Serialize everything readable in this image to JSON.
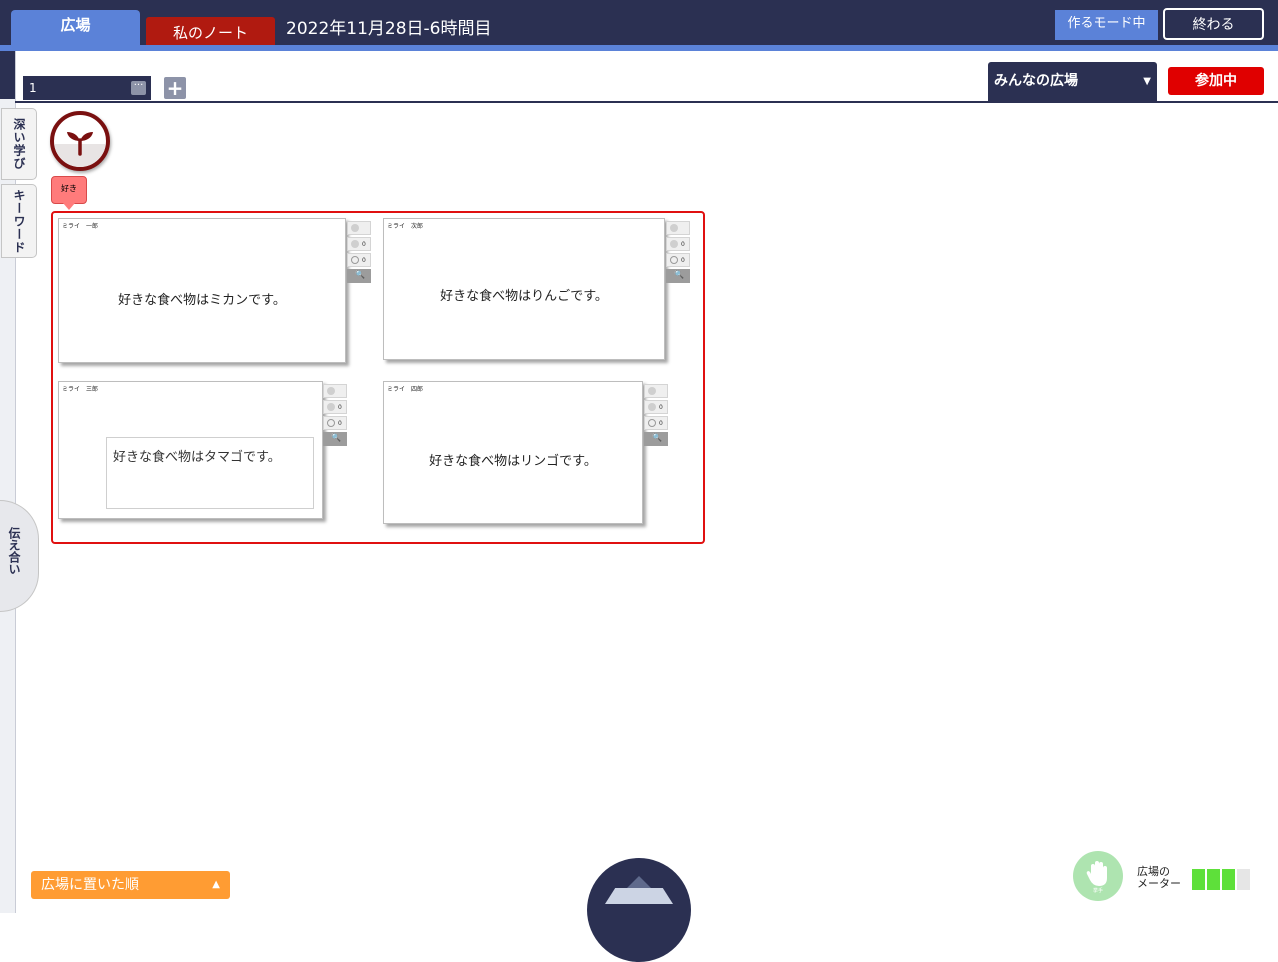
{
  "header": {
    "tab_hiroba": "広場",
    "tab_note": "私のノート",
    "session_title": "2022年11月28日-6時間目",
    "mode_button": "作るモード中",
    "end_button": "終わる"
  },
  "sidebar": {
    "tab_deep": "深い学び",
    "tab_keyword": "キーワード",
    "tab_tsutae": "伝え合い"
  },
  "toolbar": {
    "page_tab_label": "1",
    "page_tab_more": "···",
    "add_page": "+",
    "space_select": "みんなの広場",
    "join_button": "参加中"
  },
  "group": {
    "tag_label": "好き"
  },
  "cards": [
    {
      "author": "ミライ　一郎",
      "text": "好きな食べ物はミカンです。",
      "count_a": "0",
      "count_b": "0"
    },
    {
      "author": "ミライ　次郎",
      "text": "好きな食べ物はりんごです。",
      "count_a": "0",
      "count_b": "0"
    },
    {
      "author": "ミライ　三郎",
      "text": "好きな食べ物はタマゴです。",
      "count_a": "0",
      "count_b": "0"
    },
    {
      "author": "ミライ　四郎",
      "text": "好きな食べ物はリンゴです。",
      "count_a": "0",
      "count_b": "0"
    }
  ],
  "footer": {
    "sort_button": "広場に置いた順",
    "meter_label_line1": "広場の",
    "meter_label_line2": "メーター",
    "meter_level": 3,
    "meter_max": 4,
    "hand_label": "挙手"
  },
  "colors": {
    "header_navy": "#2b3052",
    "accent_blue": "#5b82d8",
    "note_red": "#b01a10",
    "join_red": "#e00000",
    "group_red": "#e01010",
    "sort_orange": "#ff9c33",
    "meter_on": "#5ee03a",
    "meter_off": "#e6e6e6"
  },
  "icons": {
    "sprout": "sprout-icon",
    "upload": "upload-tray-icon",
    "hand": "raise-hand-icon",
    "like": "like-icon",
    "comment": "comment-icon",
    "keyword": "keyword-icon"
  }
}
